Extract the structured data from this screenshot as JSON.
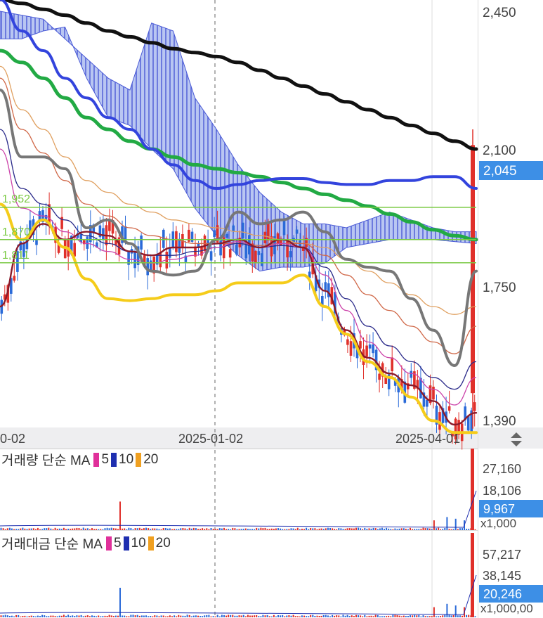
{
  "price_axis": {
    "ticks": [
      "2,450",
      "2,100",
      "1,750",
      "1,390"
    ],
    "current_price": "2,045",
    "current_color": "#3d8fe6",
    "levels": [
      {
        "label": "1,952",
        "value": 1952
      },
      {
        "label": "1,870",
        "value": 1870
      },
      {
        "label": "1,811",
        "value": 1811
      }
    ],
    "level_color": "#7ac943"
  },
  "date_axis": {
    "labels": [
      "0-02",
      "2025-01-02",
      "2025-04-01"
    ]
  },
  "volume_panel": {
    "title": "거래량 단순 MA",
    "ma": [
      {
        "label": "5",
        "color": "#e0309a"
      },
      {
        "label": "10",
        "color": "#1f2fb0"
      },
      {
        "label": "20",
        "color": "#f0a020"
      }
    ],
    "ticks": [
      "27,160",
      "18,106"
    ],
    "current": "9,967",
    "unit": "x1,000"
  },
  "amount_panel": {
    "title": "거래대금 단순 MA",
    "ma": [
      {
        "label": "5",
        "color": "#e0309a"
      },
      {
        "label": "10",
        "color": "#1f2fb0"
      },
      {
        "label": "20",
        "color": "#f0a020"
      }
    ],
    "ticks": [
      "57,217",
      "38,145"
    ],
    "current": "20,246",
    "unit": "x1,000,00"
  },
  "chart_data": {
    "type": "line",
    "series": [
      {
        "values": [
          2480,
          2470,
          2455,
          2440,
          2420,
          2400,
          2385,
          2370,
          2355,
          2345,
          2335,
          2320,
          2300,
          2280,
          2260,
          2240,
          2220,
          2200,
          2180,
          2160,
          2140,
          2120,
          2100
        ],
        "color": "#111111"
      },
      {
        "values": [
          2350,
          2320,
          2280,
          2230,
          2180,
          2150,
          2120,
          2100,
          2080,
          2060,
          2050,
          2040,
          2030,
          2015,
          2000,
          1985,
          1970,
          1955,
          1935,
          1915,
          1895,
          1880,
          1870
        ],
        "color": "#22aa44"
      },
      {
        "values": [
          2480,
          2400,
          2350,
          2280,
          2230,
          2180,
          2150,
          2100,
          2060,
          2020,
          2000,
          2010,
          2020,
          2025,
          2025,
          2015,
          2010,
          2010,
          2020,
          2020,
          2030,
          2030,
          2000
        ],
        "color": "#3344dd"
      },
      {
        "values": [
          1700,
          1860,
          1910,
          1870,
          1890,
          1880,
          1840,
          1830,
          1850,
          1850,
          1860,
          1870,
          1850,
          1870,
          1850,
          1740,
          1640,
          1570,
          1530,
          1500,
          1460,
          1400,
          1430
        ],
        "color": "#8b1a2a"
      },
      {
        "values": [
          2250,
          2080,
          2080,
          2050,
          1900,
          1920,
          1860,
          1790,
          1780,
          1790,
          1870,
          1940,
          1910,
          1920,
          1940,
          1890,
          1820,
          1800,
          1790,
          1720,
          1640,
          1550,
          1790
        ],
        "color": "#777777"
      },
      {
        "values": [
          1960,
          1870,
          1920,
          1850,
          1770,
          1720,
          1715,
          1720,
          1730,
          1730,
          1740,
          1760,
          1760,
          1760,
          1780,
          1700,
          1630,
          1560,
          1520,
          1470,
          1410,
          1380,
          1380
        ],
        "color": "#f5cc1a"
      }
    ],
    "ylim": [
      1390,
      2470
    ]
  }
}
